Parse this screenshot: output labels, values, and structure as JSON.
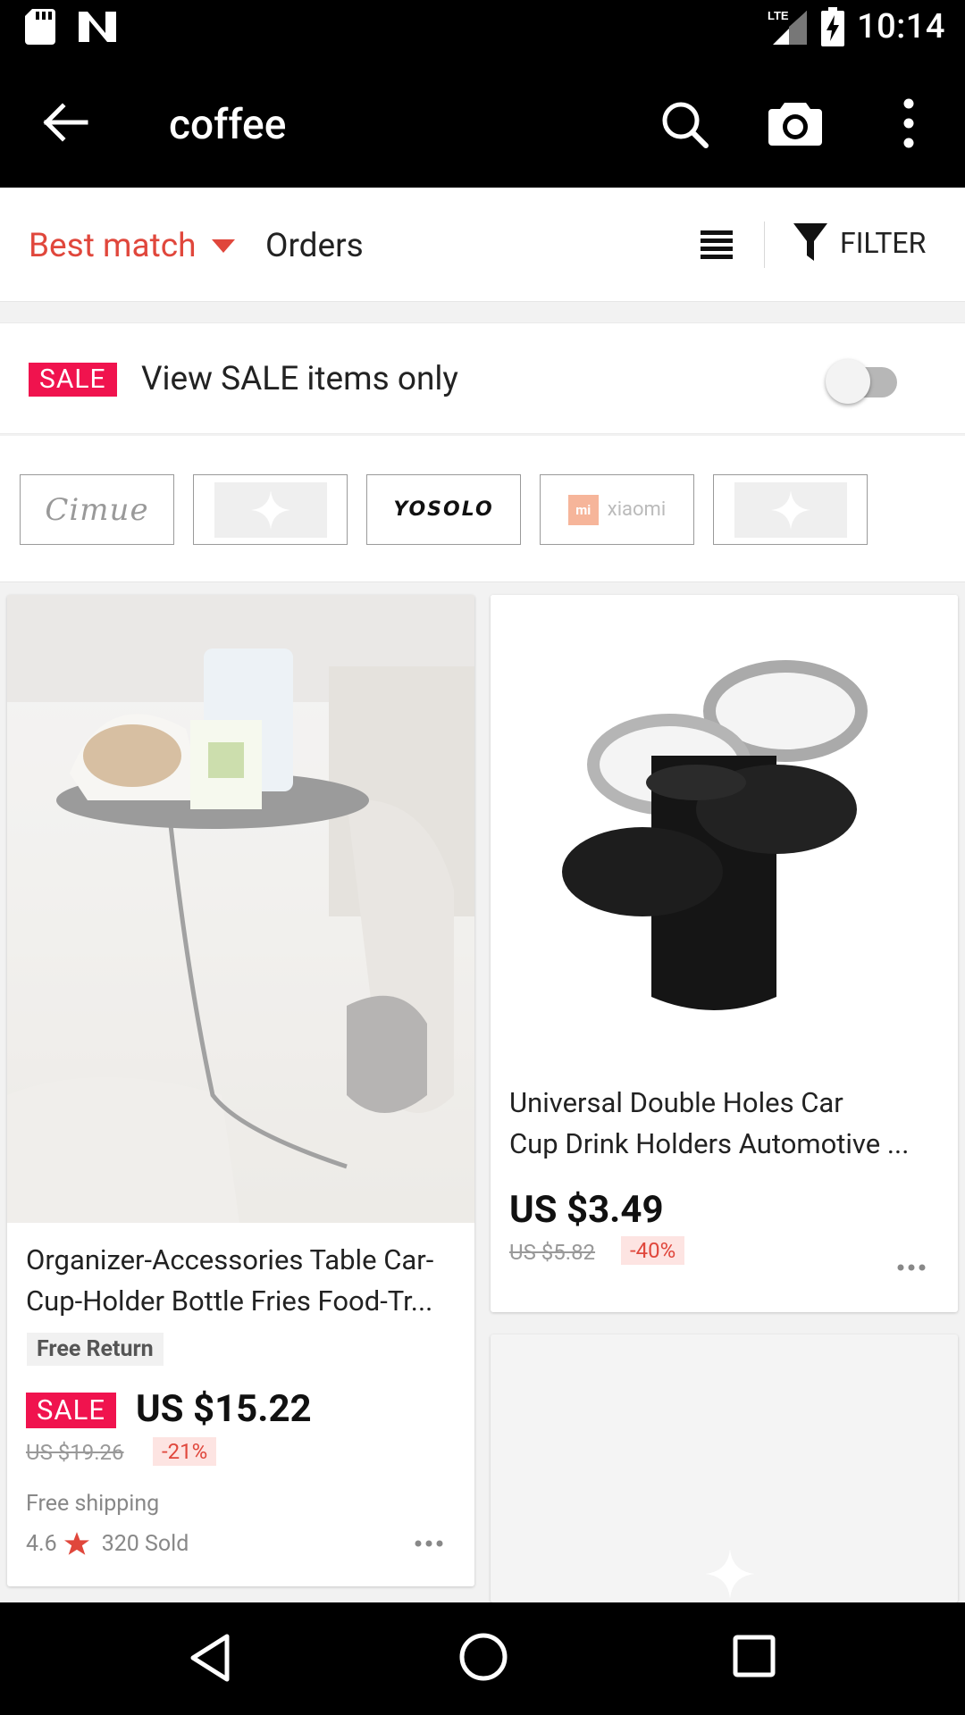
{
  "status_bar": {
    "time": "10:14",
    "network": "LTE"
  },
  "app_bar": {
    "search_query": "coffee"
  },
  "sort_bar": {
    "best_match_label": "Best match",
    "orders_label": "Orders",
    "filter_label": "FILTER",
    "active_color": "#e0473c"
  },
  "sale_filter": {
    "badge": "SALE",
    "label": "View SALE items only",
    "enabled": false
  },
  "brands": [
    {
      "name": "Cimue"
    },
    {
      "name": ""
    },
    {
      "name": "YOSOLO"
    },
    {
      "name": "xiaomi",
      "mark": "mi"
    },
    {
      "name": ""
    }
  ],
  "products": [
    {
      "title_line1": "Organizer-Accessories Table Car-",
      "title_line2": "Cup-Holder Bottle Fries Food-Tr...",
      "tag": "Free Return",
      "sale_badge": "SALE",
      "price": "US $15.22",
      "old_price": "US $19.26",
      "discount": "-21%",
      "shipping": "Free shipping",
      "rating": "4.6",
      "sold": "320 Sold"
    },
    {
      "title_line1": "Universal Double Holes Car",
      "title_line2": "Cup Drink Holders Automotive ...",
      "price": "US $3.49",
      "old_price": "US $5.82",
      "discount": "-40%"
    }
  ]
}
